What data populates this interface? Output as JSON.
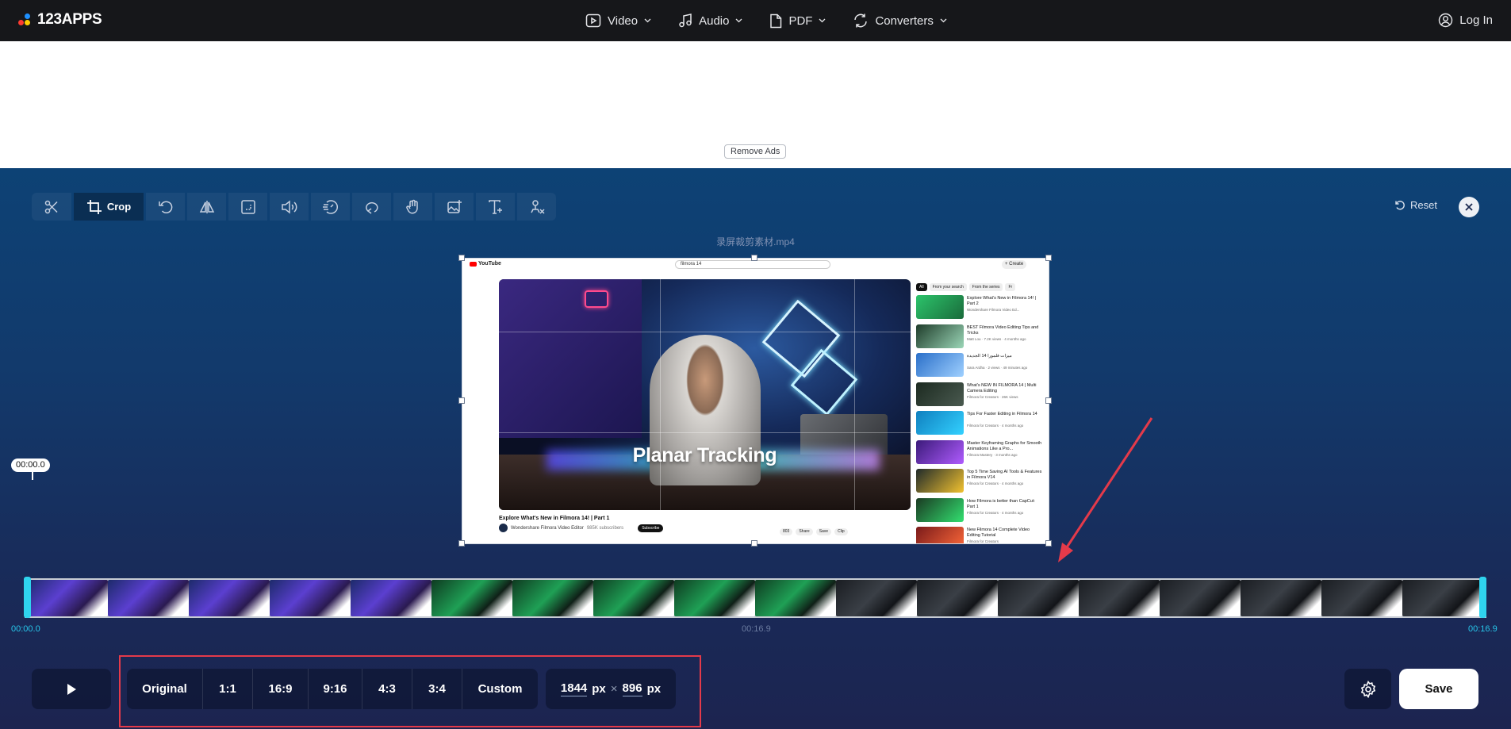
{
  "header": {
    "logo_text": "123APPS",
    "nav": [
      {
        "label": "Video",
        "icon": "video-icon"
      },
      {
        "label": "Audio",
        "icon": "music-note-icon"
      },
      {
        "label": "PDF",
        "icon": "pdf-file-icon"
      },
      {
        "label": "Converters",
        "icon": "convert-icon"
      }
    ],
    "login_label": "Log In"
  },
  "ad": {
    "remove_ads_label": "Remove Ads"
  },
  "toolbar": {
    "active_tool_label": "Crop",
    "tools": [
      "cut-icon",
      "crop-icon",
      "rotate-icon",
      "flip-icon",
      "resize-icon",
      "volume-icon",
      "speed-icon",
      "loop-icon",
      "stabilize-icon",
      "add-image-icon",
      "add-text-icon",
      "remove-logo-icon"
    ],
    "reset_label": "Reset"
  },
  "video": {
    "filename": "录屏裁剪素材.mp4",
    "youtube": {
      "search_text": "filmora 14",
      "create_label": "+ Create",
      "caption": "Planar Tracking",
      "title": "Explore What's New in Filmora 14! | Part 1",
      "channel": "Wondershare Filmora Video Editor",
      "subscribers": "985K subscribers",
      "subscribe_label": "Subscribe",
      "actions": [
        "803",
        "Share",
        "Save",
        "Clip"
      ],
      "chips": [
        "All",
        "From your search",
        "From the series",
        "Fr"
      ],
      "recommendations": [
        {
          "title": "Explore What's New in Filmora 14! | Part 2",
          "meta": "Wondershare Filmora Video Ed..."
        },
        {
          "title": "BEST Filmora Video Editing Tips and Tricks",
          "meta": "Matt Lou · 7.2K views · 4 months ago"
        },
        {
          "title": "ميزات فلمورا 14 الجديدة",
          "meta": "Sara Ardha · 2 views · 49 minutes ago"
        },
        {
          "title": "What's NEW IN FILMORA 14 | Multi Camera Editing",
          "meta": "Filmora for Creators · 26K views"
        },
        {
          "title": "Tips For Faster Editing in Filmora 14",
          "meta": "Filmora for Creators · 4 months ago"
        },
        {
          "title": "Master Keyframing Graphs for Smooth Animations Like a Pro...",
          "meta": "Filmora Mastery · 3 months ago"
        },
        {
          "title": "Top 5 Time Saving AI Tools & Features in Filmora V14",
          "meta": "Filmora for Creators · 4 months ago"
        },
        {
          "title": "How Filmora is better than CapCut: Part 1",
          "meta": "Filmora for Creators · 4 months ago"
        },
        {
          "title": "New Filmora 14 Complete Video Editing Tutorial",
          "meta": "Filmora for Creators"
        }
      ]
    }
  },
  "timeline": {
    "current_badge": "00:00.0",
    "start_time": "00:00.0",
    "middle_time": "00:16.9",
    "end_time": "00:16.9",
    "frame_count": 18
  },
  "controls": {
    "ratios": [
      "Original",
      "1:1",
      "16:9",
      "9:16",
      "4:3",
      "3:4",
      "Custom"
    ],
    "width": "1844",
    "height": "896",
    "unit": "px",
    "save_label": "Save"
  },
  "colors": {
    "header_bg": "#16171a",
    "editor_bg_top": "#0d4275",
    "editor_bg_bottom": "#1c2450",
    "timeline_handle": "#2fd4ef",
    "highlight_box": "#e43a4a",
    "annotation_arrow": "#e43a4a"
  }
}
